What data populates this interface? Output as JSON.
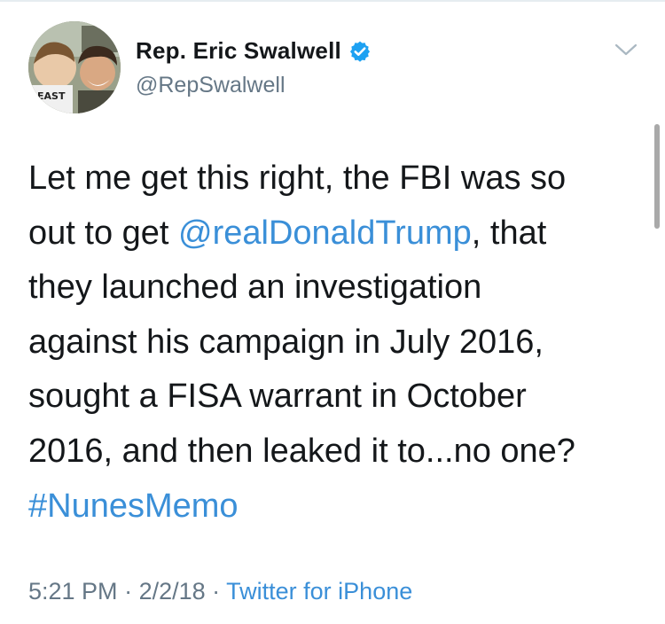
{
  "tweet": {
    "display_name": "Rep. Eric Swalwell",
    "handle": "@RepSwalwell",
    "text_lines": [
      {
        "before": "Let me get this right, the FBI was so",
        "link": "",
        "after": ""
      },
      {
        "before": "out to get ",
        "link": "@realDonaldTrump",
        "after": ", that"
      },
      {
        "before": "they launched an investigation",
        "link": "",
        "after": ""
      },
      {
        "before": "against his campaign in July 2016,",
        "link": "",
        "after": ""
      },
      {
        "before": "sought a FISA warrant in October",
        "link": "",
        "after": ""
      },
      {
        "before": "2016, and then leaked it to...no one?",
        "link": "",
        "after": ""
      },
      {
        "before": "",
        "link": "#NunesMemo",
        "after": ""
      }
    ],
    "time": "5:21 PM",
    "separator": " · ",
    "date": "2/2/18",
    "source": "Twitter for iPhone"
  },
  "colors": {
    "link": "#3a8fd8",
    "verified_badge": "#1da1f2",
    "muted": "#657786"
  },
  "icons": {
    "verified": "verified-badge-icon",
    "caret": "chevron-down-icon",
    "avatar": "profile-avatar-photo"
  }
}
